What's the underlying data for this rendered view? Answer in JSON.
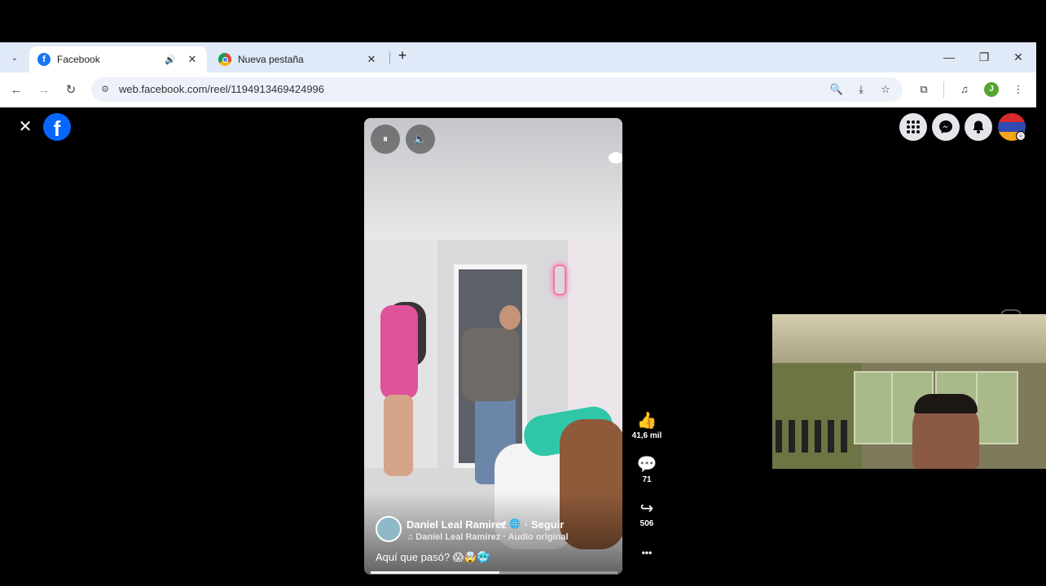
{
  "browser": {
    "tabs": [
      {
        "title": "Facebook",
        "icon": "facebook-favicon",
        "active": true
      },
      {
        "title": "Nueva pestaña",
        "icon": "chrome-favicon",
        "active": false
      }
    ],
    "url": "web.facebook.com/reel/1194913469424996",
    "profile_initial": "J",
    "glyphs": {
      "tab_menu": "⌄",
      "mute": "🔊",
      "close": "✕",
      "new_tab": "+",
      "minimize": "—",
      "restore": "❐",
      "close_window": "✕",
      "back": "←",
      "forward": "→",
      "reload": "↻",
      "site_info": "⚙",
      "zoom": "🔍",
      "install": "⤓",
      "bookmark": "☆",
      "extensions": "⧉",
      "media": "♫",
      "menu": "⋮"
    }
  },
  "facebook": {
    "close_glyph": "✕",
    "logo_letter": "f",
    "header_icons": [
      "menu-grid-icon",
      "messenger-icon",
      "notifications-icon"
    ],
    "header_glyphs": [
      "⋮⋮⋮",
      "⚡",
      "🔔"
    ],
    "avatar_badge_glyph": "⌄"
  },
  "reel": {
    "controls": {
      "pause_glyph": "⏸",
      "volume_glyph": "🔈"
    },
    "author": "Daniel Leal Ramirez",
    "author_badges": "✔ 🌐",
    "follow": "· Seguir",
    "audio": "♫ Daniel Leal Ramirez · Audio original",
    "caption": "Aquí que pasó? 😱🤯🥶",
    "progress": 0.52,
    "actions": [
      {
        "name": "like",
        "icon": "👍",
        "count": "41,6 mil"
      },
      {
        "name": "comment",
        "icon": "💬",
        "count": "71"
      },
      {
        "name": "share",
        "icon": "↪",
        "count": "506"
      },
      {
        "name": "more",
        "icon": "•••",
        "count": ""
      }
    ]
  }
}
